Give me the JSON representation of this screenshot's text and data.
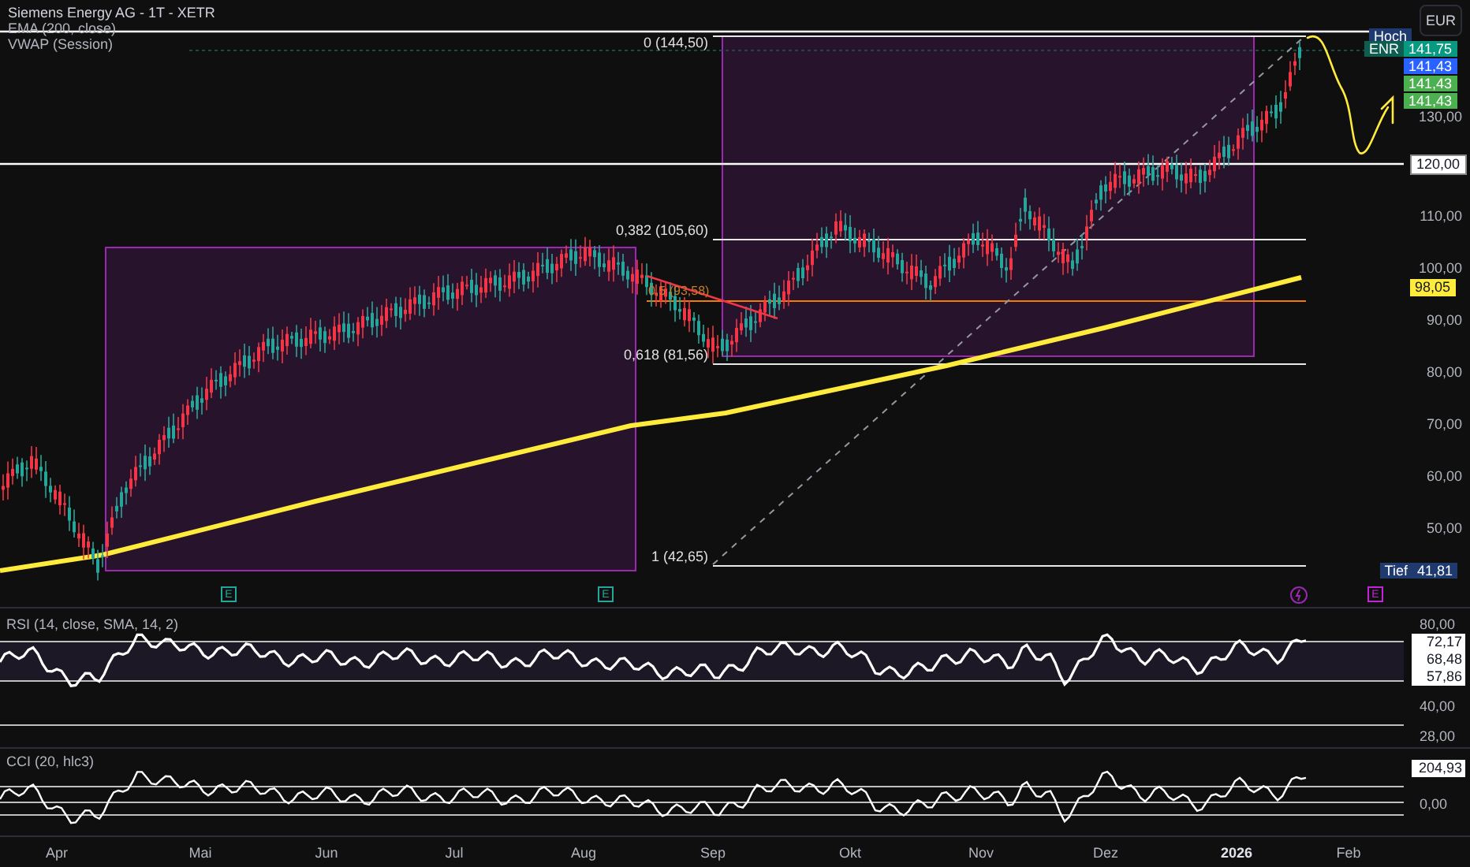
{
  "header": {
    "title": "Siemens Energy AG - 1T - XETR",
    "indicators": [
      "EMA (200, close)",
      "VWAP (Session)"
    ]
  },
  "currency": "EUR",
  "price_scale": [
    {
      "label": "130,00",
      "kind": "tick"
    },
    {
      "label": "120,00",
      "kind": "marker"
    },
    {
      "label": "110,00",
      "kind": "tick"
    },
    {
      "label": "100,00",
      "kind": "tick"
    },
    {
      "label": "90,00",
      "kind": "tick"
    },
    {
      "label": "80,00",
      "kind": "tick"
    },
    {
      "label": "70,00",
      "kind": "tick"
    },
    {
      "label": "60,00",
      "kind": "tick"
    },
    {
      "label": "50,00",
      "kind": "tick"
    }
  ],
  "price_badges": [
    {
      "tag": "Hoch",
      "color": "#1e3a6e"
    },
    {
      "tag": "ENR",
      "value": "141,75",
      "color": "#089981"
    },
    {
      "value": "141,43",
      "color": "#2962ff"
    },
    {
      "value": "141,43",
      "color": "#4caf50"
    },
    {
      "value": "141,43",
      "color": "#4caf50"
    }
  ],
  "ema_badge": "98,05",
  "low_badge": {
    "tag": "Tief",
    "value": "41,81"
  },
  "fib_levels": [
    "0 (144,50)",
    "0,382 (105,60)",
    "0,618 (81,56)",
    "1 (42,65)"
  ],
  "fib_mid_label": "0,5 (93,58)",
  "events": [
    {
      "kind": "earnings",
      "label": "E"
    },
    {
      "kind": "earnings",
      "label": "E"
    },
    {
      "kind": "split"
    },
    {
      "kind": "dividend",
      "label": "E"
    }
  ],
  "rsi": {
    "title": "RSI (14, close, SMA, 14, 2)",
    "scale": [
      "80,00",
      "40,00",
      "28,00"
    ],
    "badges": [
      "72,17",
      "68,48",
      "57,86"
    ]
  },
  "cci": {
    "title": "CCI (20, hlc3)",
    "scale": [
      "0,00"
    ],
    "badges": [
      "204,93"
    ]
  },
  "time_axis": [
    {
      "label": "Apr",
      "kind": "month"
    },
    {
      "label": "Mai",
      "kind": "month"
    },
    {
      "label": "Jun",
      "kind": "month"
    },
    {
      "label": "Jul",
      "kind": "month"
    },
    {
      "label": "Aug",
      "kind": "month"
    },
    {
      "label": "Sep",
      "kind": "month"
    },
    {
      "label": "Okt",
      "kind": "month"
    },
    {
      "label": "Nov",
      "kind": "month"
    },
    {
      "label": "Dez",
      "kind": "month"
    },
    {
      "label": "2026",
      "kind": "year"
    },
    {
      "label": "Feb",
      "kind": "month"
    }
  ]
}
